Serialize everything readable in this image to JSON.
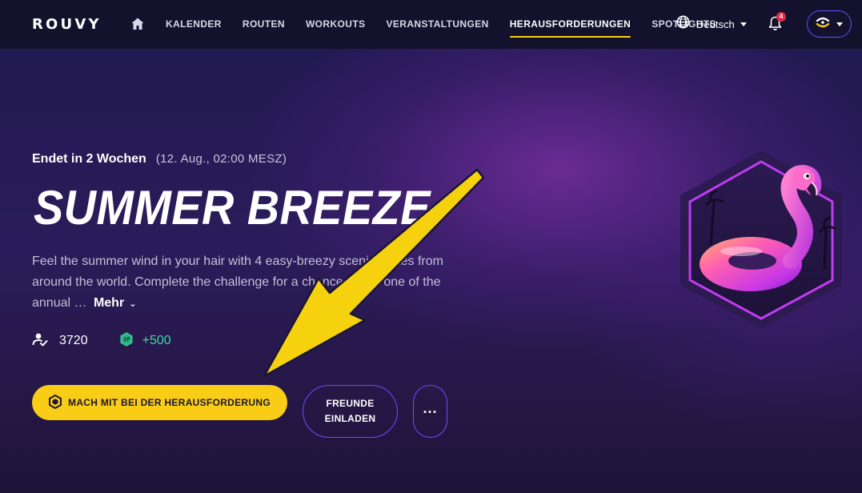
{
  "navbar": {
    "logo_text": "ROUVY",
    "items": [
      {
        "label": "KALENDER",
        "active": false
      },
      {
        "label": "ROUTEN",
        "active": false
      },
      {
        "label": "WORKOUTS",
        "active": false
      },
      {
        "label": "VERANSTALTUNGEN",
        "active": false
      },
      {
        "label": "HERAUSFORDERUNGEN",
        "active": true
      },
      {
        "label": "SPOTLIGHTS",
        "active": false
      }
    ],
    "language": "Deutsch",
    "notification_count": "4",
    "icons": {
      "home": "home-icon",
      "language": "globe-icon",
      "notifications": "bell-icon",
      "profile": "rouvy-avatar-icon"
    }
  },
  "challenge": {
    "deadline": "Endet in 2 Wochen",
    "deadline_date": "(12. Aug., 02:00 MESZ)",
    "title": "SUMMER BREEZE",
    "description": "Feel the summer wind in your hair with 4 easy-breezy scenic routes from around the world. Complete the challenge for a chance to win one of the annual …",
    "more_label": "Mehr",
    "participants": "3720",
    "xp": "+500",
    "join_button": "MACH MIT BEI DER HERAUSFORDERUNG",
    "invite_line1": "FREUNDE",
    "invite_line2": "EINLADEN",
    "more_button": "...",
    "badge": "flamingo-float-badge"
  },
  "colors": {
    "accent_yellow": "#f9cd16",
    "accent_purple": "#6f4cff",
    "xp_green": "#41d6a3",
    "nav_bg": "#13112c",
    "badge_magenta": "#c03cf0"
  }
}
